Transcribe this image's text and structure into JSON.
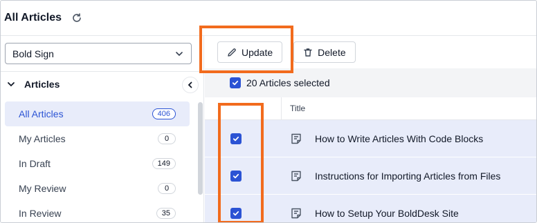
{
  "header": {
    "title": "All Articles",
    "refresh_icon": "refresh-icon"
  },
  "sidebar": {
    "brand_select": {
      "value": "Bold Sign",
      "icon": "chevron-down-icon"
    },
    "section": {
      "label": "Articles",
      "icon": "chevron-down-icon"
    },
    "collapse_icon": "chevron-left-icon",
    "items": [
      {
        "label": "All Articles",
        "count": "406",
        "active": true
      },
      {
        "label": "My Articles",
        "count": "0"
      },
      {
        "label": "In Draft",
        "count": "149"
      },
      {
        "label": "My Review",
        "count": "0"
      },
      {
        "label": "In Review",
        "count": "35"
      }
    ]
  },
  "toolbar": {
    "update_label": "Update",
    "update_icon": "pencil-icon",
    "delete_label": "Delete",
    "delete_icon": "trash-icon"
  },
  "selection": {
    "label": "20 Articles selected"
  },
  "table": {
    "columns": [
      "Title"
    ],
    "rows": [
      {
        "title": "How to Write Articles With Code Blocks",
        "checked": true
      },
      {
        "title": "Instructions for Importing Articles from Files",
        "checked": true
      },
      {
        "title": "How to Setup Your BoldDesk Site",
        "checked": true
      }
    ]
  },
  "colors": {
    "accent": "#2b53d4",
    "highlight": "#f26b1d",
    "row_selected": "#e8ecfa"
  }
}
